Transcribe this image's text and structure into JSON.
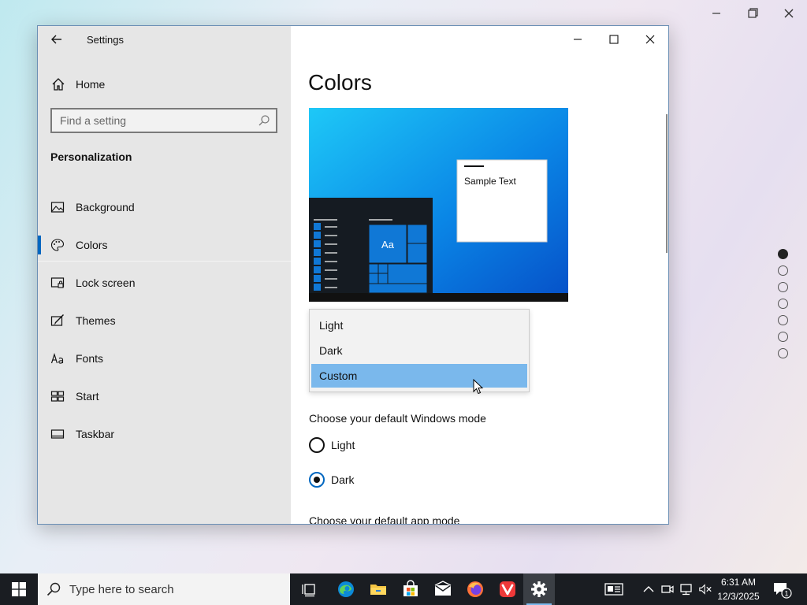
{
  "window": {
    "title": "Settings"
  },
  "sidebar": {
    "home_label": "Home",
    "search_placeholder": "Find a setting",
    "section_title": "Personalization",
    "items": [
      {
        "label": "Background",
        "icon": "picture-icon"
      },
      {
        "label": "Colors",
        "icon": "palette-icon",
        "active": true
      },
      {
        "label": "Lock screen",
        "icon": "lock-screen-icon"
      },
      {
        "label": "Themes",
        "icon": "themes-icon"
      },
      {
        "label": "Fonts",
        "icon": "fonts-icon"
      },
      {
        "label": "Start",
        "icon": "start-icon"
      },
      {
        "label": "Taskbar",
        "icon": "taskbar-icon"
      }
    ]
  },
  "content": {
    "page_title": "Colors",
    "preview": {
      "sample_text": "Sample Text",
      "tile_text": "Aa"
    },
    "color_dropdown": {
      "options": [
        "Light",
        "Dark",
        "Custom"
      ],
      "selected": "Custom"
    },
    "windows_mode": {
      "label": "Choose your default Windows mode",
      "options": [
        "Light",
        "Dark"
      ],
      "selected": "Dark"
    },
    "app_mode_label": "Choose your default app mode"
  },
  "pager": {
    "count": 7,
    "active_index": 0
  },
  "taskbar": {
    "search_placeholder": "Type here to search",
    "pinned": [
      "task-view-icon",
      "edge-icon",
      "file-explorer-icon",
      "store-icon",
      "mail-icon",
      "firefox-icon",
      "vivaldi-icon",
      "settings-icon"
    ],
    "active_app": "settings-icon",
    "clock": {
      "time": "6:31 AM",
      "date": "12/3/2025"
    },
    "notification_count": "1"
  },
  "colors": {
    "accent": "#0067c0",
    "dropdown_selected": "#7ab8ec",
    "taskbar": "#1a1d22"
  }
}
